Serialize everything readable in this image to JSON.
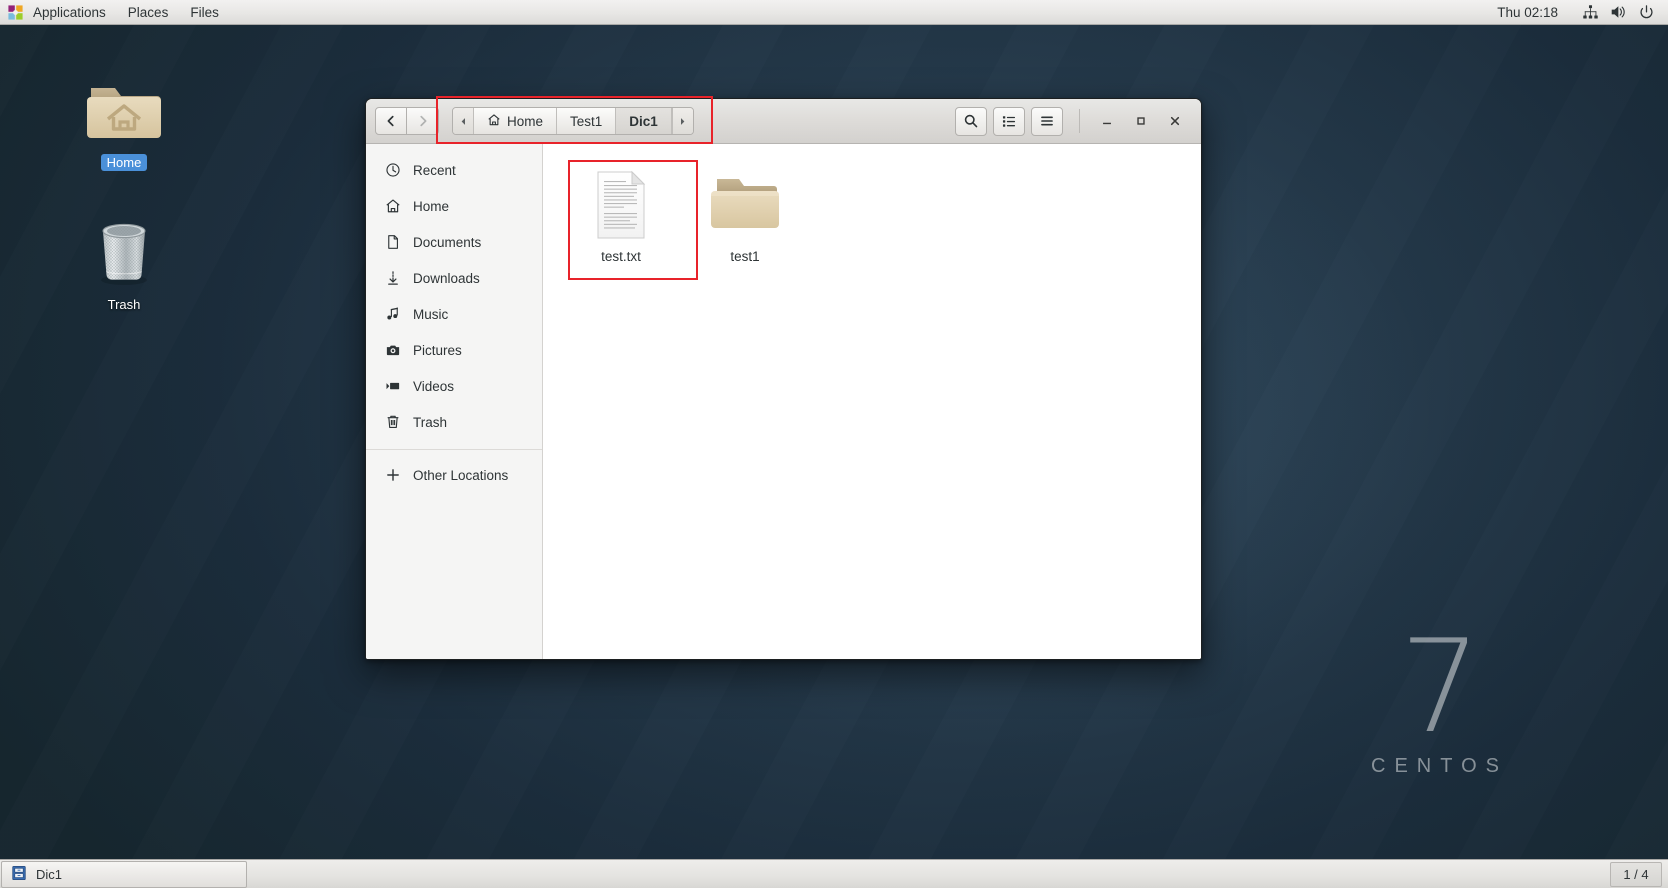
{
  "top_panel": {
    "logo_icon": "centos-logo-icon",
    "menus": [
      {
        "label": "Applications",
        "name": "menu-applications"
      },
      {
        "label": "Places",
        "name": "menu-places"
      },
      {
        "label": "Files",
        "name": "menu-files"
      }
    ],
    "clock": "Thu 02:18",
    "tray": [
      {
        "name": "network-icon",
        "label": "network"
      },
      {
        "name": "volume-icon",
        "label": "volume"
      },
      {
        "name": "power-icon",
        "label": "power"
      }
    ]
  },
  "desktop": {
    "icons": [
      {
        "name": "desktop-icon-home",
        "label": "Home",
        "icon": "home-folder-icon",
        "selected": true
      },
      {
        "name": "desktop-icon-trash",
        "label": "Trash",
        "icon": "trash-icon",
        "selected": false
      }
    ],
    "watermark": {
      "version": "7",
      "word": "CENTOS"
    }
  },
  "files_window": {
    "title": "Dic1",
    "nav": {
      "back_label": "Back",
      "forward_label": "Forward"
    },
    "breadcrumb": {
      "prev_arrow": "chevron-left-icon",
      "next_arrow": "chevron-right-icon",
      "items": [
        {
          "label": "Home",
          "icon": "home-icon",
          "current": false
        },
        {
          "label": "Test1",
          "icon": "",
          "current": false
        },
        {
          "label": "Dic1",
          "icon": "",
          "current": true
        }
      ]
    },
    "header_buttons": [
      {
        "name": "search-button",
        "icon": "search-icon",
        "label": "Search"
      },
      {
        "name": "view-toggle-button",
        "icon": "list-view-icon",
        "label": "View options"
      },
      {
        "name": "menu-button",
        "icon": "hamburger-menu-icon",
        "label": "Menu"
      }
    ],
    "window_controls": [
      {
        "name": "minimize-button",
        "icon": "minimize-icon",
        "label": "Minimize"
      },
      {
        "name": "maximize-button",
        "icon": "maximize-icon",
        "label": "Maximize"
      },
      {
        "name": "close-button",
        "icon": "close-icon",
        "label": "Close"
      }
    ],
    "sidebar": {
      "items": [
        {
          "label": "Recent",
          "icon": "clock-icon",
          "name": "sidebar-item-recent"
        },
        {
          "label": "Home",
          "icon": "home-icon",
          "name": "sidebar-item-home"
        },
        {
          "label": "Documents",
          "icon": "document-icon",
          "name": "sidebar-item-documents"
        },
        {
          "label": "Downloads",
          "icon": "download-icon",
          "name": "sidebar-item-downloads"
        },
        {
          "label": "Music",
          "icon": "music-note-icon",
          "name": "sidebar-item-music"
        },
        {
          "label": "Pictures",
          "icon": "camera-icon",
          "name": "sidebar-item-pictures"
        },
        {
          "label": "Videos",
          "icon": "video-icon",
          "name": "sidebar-item-videos"
        },
        {
          "label": "Trash",
          "icon": "trash-icon",
          "name": "sidebar-item-trash"
        }
      ],
      "other_locations": {
        "label": "Other Locations",
        "icon": "plus-icon",
        "name": "sidebar-item-other-locations"
      }
    },
    "files": [
      {
        "label": "test.txt",
        "type": "text-file",
        "name": "file-item-test-txt",
        "highlighted": true
      },
      {
        "label": "test1",
        "type": "folder",
        "name": "file-item-test1",
        "highlighted": false
      }
    ]
  },
  "bottom_panel": {
    "task_button": {
      "label": "Dic1",
      "icon": "file-manager-icon"
    },
    "workspace": "1 / 4"
  },
  "annotations": {
    "accent_color": "#e8232a",
    "boxes": [
      {
        "name": "annotation-breadcrumb",
        "target": "breadcrumb"
      },
      {
        "name": "annotation-file",
        "target": "test.txt"
      }
    ]
  }
}
